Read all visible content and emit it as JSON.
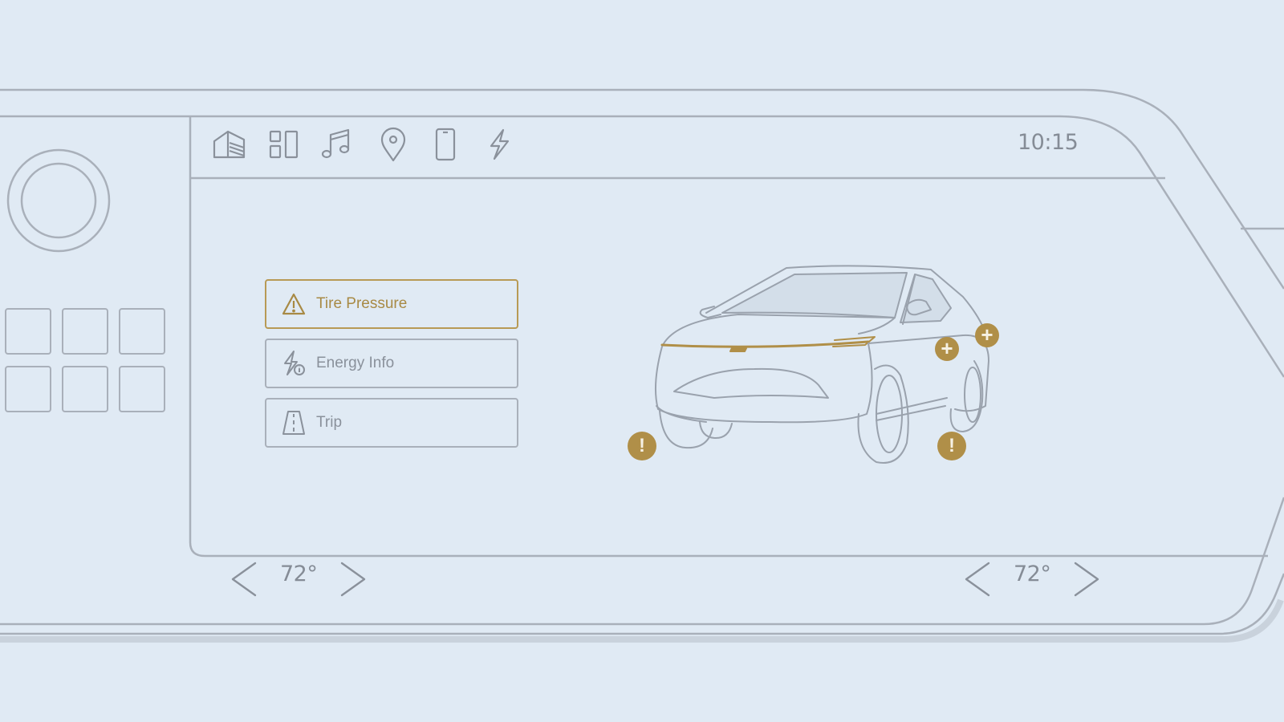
{
  "status_bar": {
    "clock": "10:15"
  },
  "nav_icons": [
    {
      "name": "home-icon"
    },
    {
      "name": "apps-icon"
    },
    {
      "name": "music-icon"
    },
    {
      "name": "location-pin-icon"
    },
    {
      "name": "phone-icon"
    },
    {
      "name": "energy-bolt-icon"
    }
  ],
  "vehicle_menu": {
    "items": [
      {
        "label": "Tire Pressure",
        "icon": "warning-triangle-icon",
        "active": true
      },
      {
        "label": "Energy Info",
        "icon": "energy-info-icon",
        "active": false
      },
      {
        "label": "Trip",
        "icon": "road-icon",
        "active": false
      }
    ]
  },
  "climate": {
    "driver_temp": "72°",
    "passenger_temp": "72°"
  },
  "tire_indicators": {
    "front_left": "!",
    "front_right": "!",
    "rear_right_a": "+",
    "rear_right_b": "+"
  },
  "colors": {
    "background": "#e0eaf4",
    "line": "#a9b0ba",
    "accent": "#b08f48",
    "text": "#858c96"
  }
}
